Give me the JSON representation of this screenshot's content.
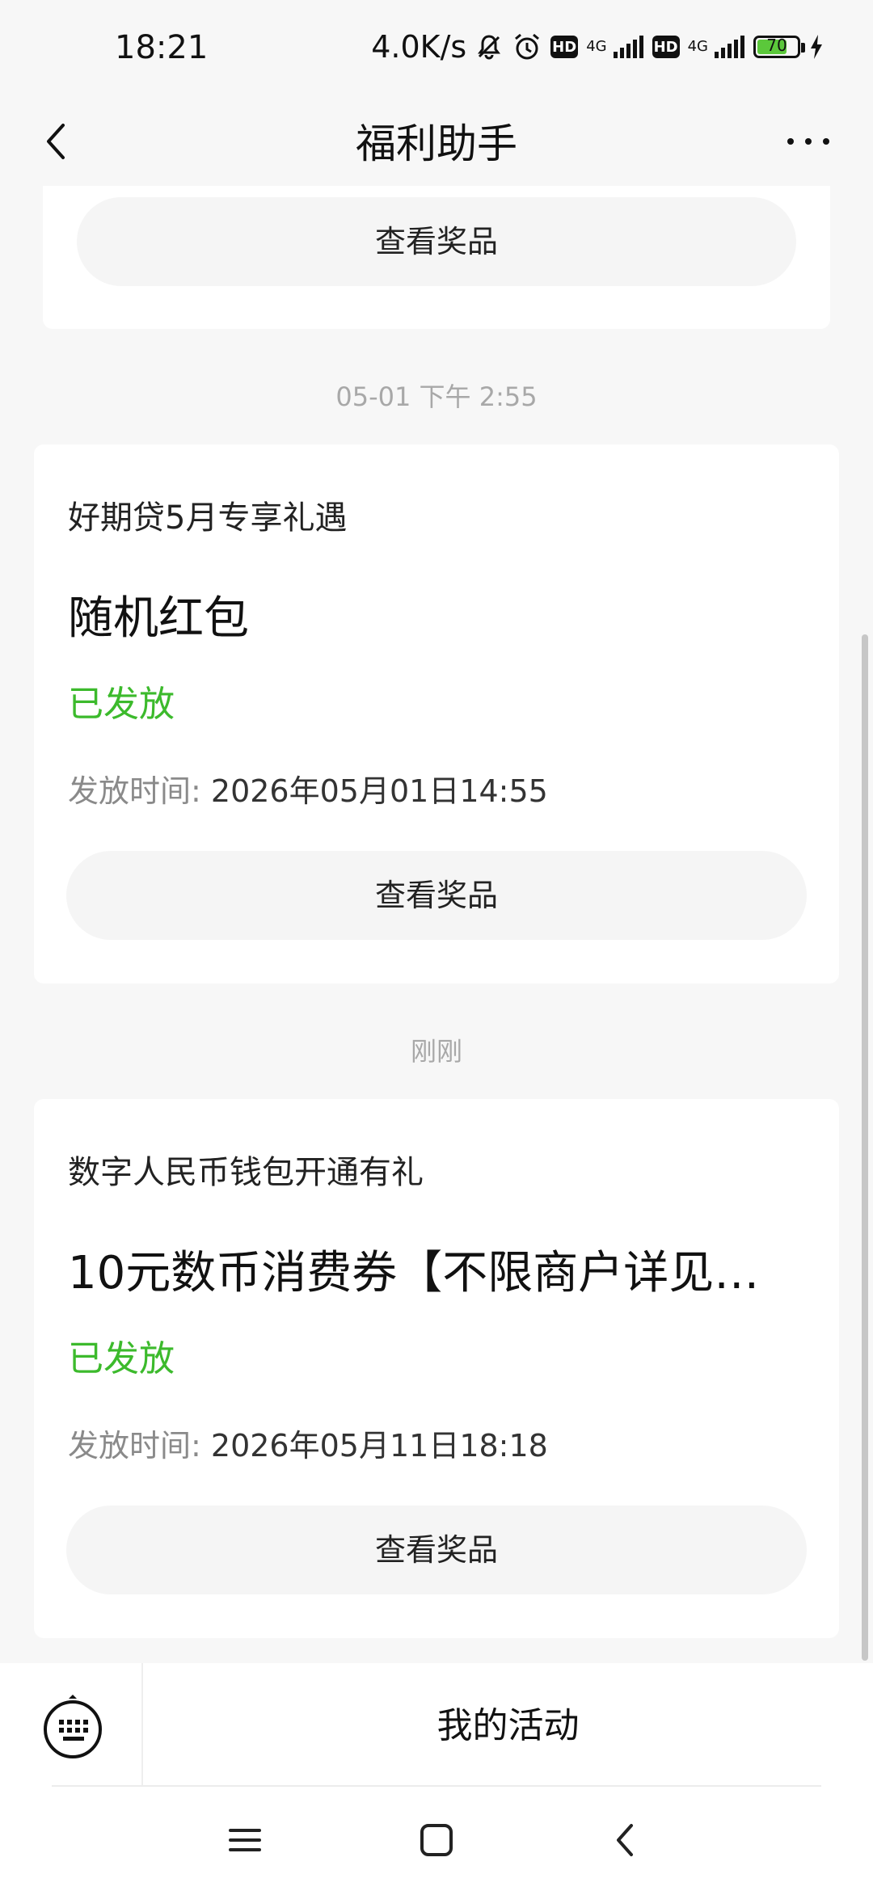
{
  "status_bar": {
    "time": "18:21",
    "speed": "4.0K/s",
    "hd1": "HD",
    "net1": "4G",
    "hd2": "HD",
    "net2": "4G",
    "battery": "70",
    "icons": [
      "mute-bell-icon",
      "alarm-icon",
      "signal-icon",
      "charging-icon"
    ]
  },
  "header": {
    "title": "福利助手"
  },
  "cards": [
    {
      "button_label": "查看奖品"
    },
    {
      "timestamp": "05-01 下午 2:55",
      "subtitle": "好期贷5月专享礼遇",
      "title": "随机红包",
      "status": "已发放",
      "time_label": "发放时间:",
      "time_value": "2026年05月01日14:55",
      "button_label": "查看奖品"
    },
    {
      "timestamp": "刚刚",
      "subtitle": "数字人民币钱包开通有礼",
      "title": "10元数币消费券【不限商户详见使…",
      "status": "已发放",
      "time_label": "发放时间:",
      "time_value": "2026年05月11日18:18",
      "button_label": "查看奖品"
    }
  ],
  "bottom_bar": {
    "menu_label": "我的活动"
  },
  "colors": {
    "status_green": "#3cba2c",
    "background": "#f7f7f7",
    "card": "#ffffff"
  }
}
